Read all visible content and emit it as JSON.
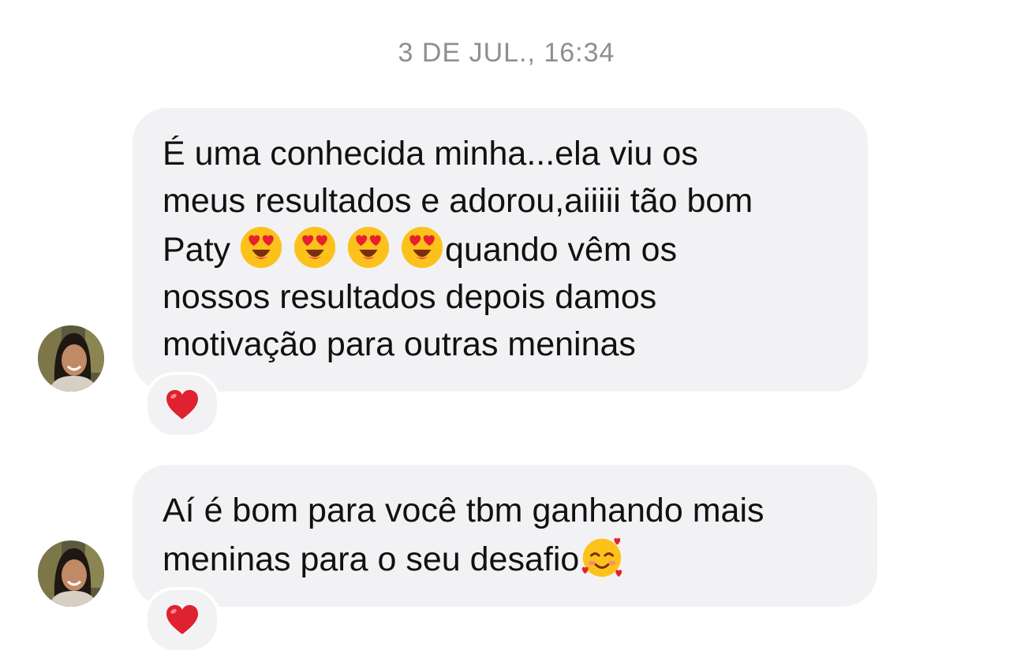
{
  "timestamp": "3 DE JUL., 16:34",
  "messages": [
    {
      "lines": [
        "É uma conhecida minha...ela viu os",
        "meus resultados e adorou,aiiiii tão bom",
        "Paty",
        "quando vêm os",
        "nossos resultados depois damos",
        "motivação para outras meninas"
      ],
      "emojis": [
        "heart-eyes-emoji",
        "heart-eyes-emoji",
        "heart-eyes-emoji",
        "heart-eyes-emoji"
      ],
      "reaction": "red-heart"
    },
    {
      "lines": [
        "Aí é bom para você tbm ganhando mais",
        "meninas para o seu desafio"
      ],
      "emojis": [
        "smiling-face-with-hearts-emoji"
      ],
      "reaction": "red-heart"
    }
  ],
  "colors": {
    "bubble": "#f2f2f4",
    "timestamp": "#8e8e93",
    "text": "#111111",
    "heart": "#e0212f"
  }
}
